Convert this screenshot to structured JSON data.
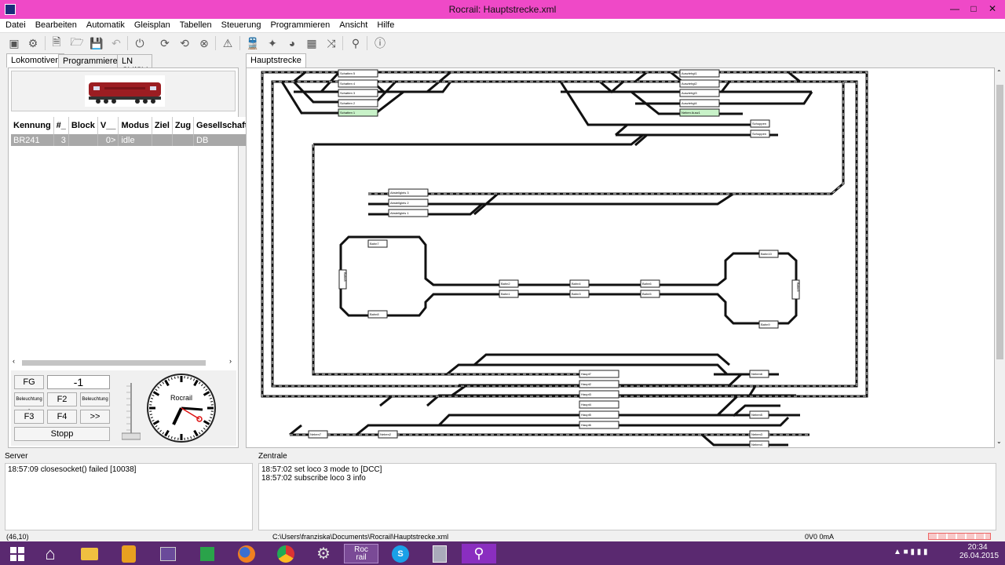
{
  "window": {
    "title": "Rocrail: Hauptstrecke.xml"
  },
  "menu": [
    "Datei",
    "Bearbeiten",
    "Automatik",
    "Gleisplan",
    "Tabellen",
    "Steuerung",
    "Programmieren",
    "Ansicht",
    "Hilfe"
  ],
  "left_tabs": [
    "Lokomotiven",
    "Programmieren",
    "LN CV/SV"
  ],
  "loco_table": {
    "headers": [
      "Kennung",
      "#_",
      "Block",
      "V__",
      "Modus",
      "Ziel",
      "Zug",
      "Gesellschaft"
    ],
    "row": [
      "BR241",
      "3",
      "",
      "0>",
      "idle",
      "",
      "",
      "DB"
    ]
  },
  "controls": {
    "fg": "FG",
    "speed": "-1",
    "beleuchtung_small": "Beleuchtung 2",
    "f2": "F2",
    "beleuchtung": "Beleuchtung",
    "f3": "F3",
    "f4": "F4",
    "more": ">>",
    "stop": "Stopp"
  },
  "clock": {
    "brand": "Rocrail"
  },
  "plan": {
    "tab": "Hauptstrecke",
    "blocks": [
      "Schatten 5",
      "Schatten 4",
      "Schatten 3",
      "Schatten 2",
      "Schatten 1",
      "Ausziehgl1",
      "Ausziehgl2",
      "Ausziehgl3",
      "Ausziehgl4",
      "Neben Ausz1",
      "Schuppen",
      "Schuppen",
      "Abstellgleis 3",
      "Abstellgleis 2",
      "Abstellgleis 1",
      "Bahn7",
      "Bahn8",
      "Bahn8",
      "Bahn2",
      "Bahn1",
      "Bahn4",
      "Bahn3",
      "Bahn6",
      "Bahn5",
      "Bahn10",
      "Bahn9",
      "Bahn9",
      "Haupt7",
      "Haupt2",
      "Haupt3",
      "Haupt4",
      "Haupt5",
      "Haupt6",
      "Neben6",
      "Neben5",
      "Neben7",
      "Neben2",
      "Neben3",
      "Neben4"
    ]
  },
  "server": {
    "label": "Server",
    "log": [
      "18:57:09 closesocket() failed [10038]"
    ]
  },
  "zentrale": {
    "label": "Zentrale",
    "log": [
      "18:57:02 set loco 3 mode to [DCC]",
      "18:57:02 subscribe loco 3 info"
    ]
  },
  "status": {
    "coords": "(46,10)",
    "path": "C:\\Users\\franziska\\Documents\\Rocrail\\Hauptstrecke.xml",
    "power": "0V0 0mA"
  },
  "taskbar": {
    "time": "20:34",
    "date": "26.04.2015",
    "rocrail_a": "Roc",
    "rocrail_b": "rail"
  }
}
